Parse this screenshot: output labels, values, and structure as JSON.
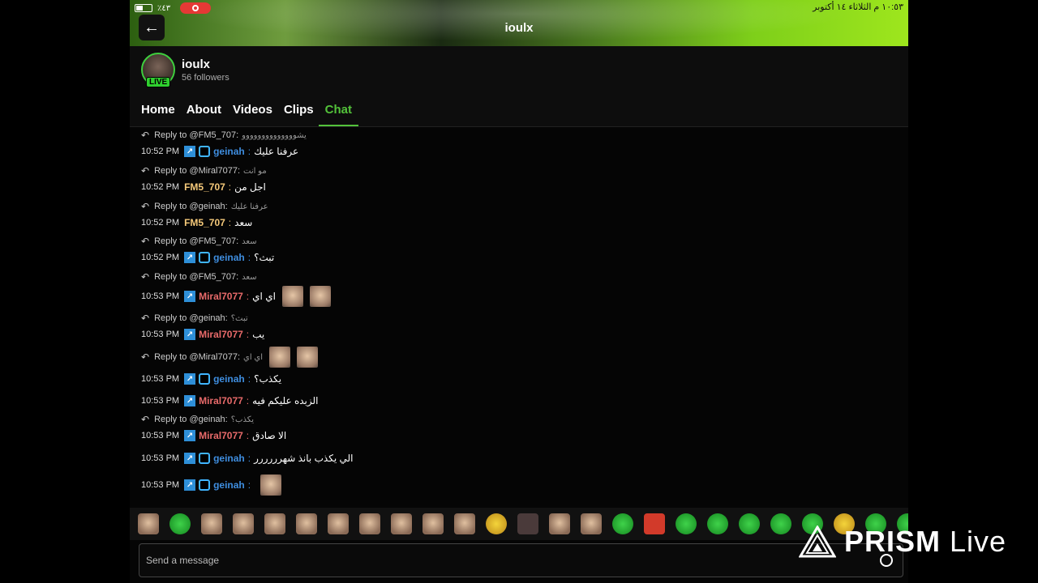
{
  "statusbar": {
    "battery": "٪٤٣",
    "right": "١٠:٥٣ م   الثلاثاء ١٤ أكتوبر"
  },
  "header": {
    "title": "ioulx"
  },
  "channel": {
    "name": "ioulx",
    "followers": "56 followers",
    "live": "LIVE"
  },
  "tabs": [
    "Home",
    "About",
    "Videos",
    "Clips",
    "Chat"
  ],
  "active_tab": "Chat",
  "colors": {
    "accent": "#53c23a",
    "geinah": "#3f8ee0",
    "fm5": "#f5c97a",
    "miral": "#e86a6a"
  },
  "chat": [
    {
      "type": "reply",
      "label": "Reply to @FM5_707:",
      "text": "يشوووووووووووووو"
    },
    {
      "type": "msg",
      "time": "10:52 PM",
      "user": "geinah",
      "badges": 2,
      "text": "عرفنا عليك"
    },
    {
      "type": "reply",
      "label": "Reply to @Miral7077:",
      "text": "مو انت"
    },
    {
      "type": "msg",
      "time": "10:52 PM",
      "user": "FM5_707",
      "badges": 0,
      "text": "اجل من"
    },
    {
      "type": "reply",
      "label": "Reply to @geinah:",
      "text": "عرفنا عليك"
    },
    {
      "type": "msg",
      "time": "10:52 PM",
      "user": "FM5_707",
      "badges": 0,
      "text": "سعد"
    },
    {
      "type": "reply",
      "label": "Reply to @FM5_707:",
      "text": "سعد"
    },
    {
      "type": "msg",
      "time": "10:52 PM",
      "user": "geinah",
      "badges": 2,
      "text": "تبث؟"
    },
    {
      "type": "reply",
      "label": "Reply to @FM5_707:",
      "text": "سعد"
    },
    {
      "type": "msg",
      "time": "10:53 PM",
      "user": "Miral7077",
      "badges": 1,
      "text": "اي اي",
      "emotes": 2
    },
    {
      "type": "reply",
      "label": "Reply to @geinah:",
      "text": "تبث؟"
    },
    {
      "type": "msg",
      "time": "10:53 PM",
      "user": "Miral7077",
      "badges": 1,
      "text": "يب"
    },
    {
      "type": "reply",
      "label": "Reply to @Miral7077:",
      "text": "اي اي",
      "emotes": 2
    },
    {
      "type": "msg",
      "time": "10:53 PM",
      "user": "geinah",
      "badges": 2,
      "text": "يكذب؟"
    },
    {
      "type": "msg",
      "time": "10:53 PM",
      "user": "Miral7077",
      "badges": 1,
      "text": "الزبده عليكم فيه"
    },
    {
      "type": "reply",
      "label": "Reply to @geinah:",
      "text": "يكذب؟"
    },
    {
      "type": "msg",
      "time": "10:53 PM",
      "user": "Miral7077",
      "badges": 1,
      "text": "الا صادق"
    },
    {
      "type": "msg",
      "time": "10:53 PM",
      "user": "geinah",
      "badges": 2,
      "text": "الي يكذب بانذ شهرررررر"
    },
    {
      "type": "msg",
      "time": "10:53 PM",
      "user": "geinah",
      "badges": 2,
      "text": "",
      "emotes": 1
    }
  ],
  "emote_bar": [
    "face",
    "green",
    "face",
    "face",
    "face",
    "face",
    "face",
    "face",
    "face",
    "face",
    "face",
    "yellow",
    "dark",
    "face",
    "face",
    "green",
    "red",
    "green",
    "green",
    "green",
    "green",
    "green",
    "yellow",
    "green",
    "green"
  ],
  "input": {
    "placeholder": "Send a message"
  },
  "watermark": {
    "brand": "PRISM",
    "suffix": "Live"
  }
}
